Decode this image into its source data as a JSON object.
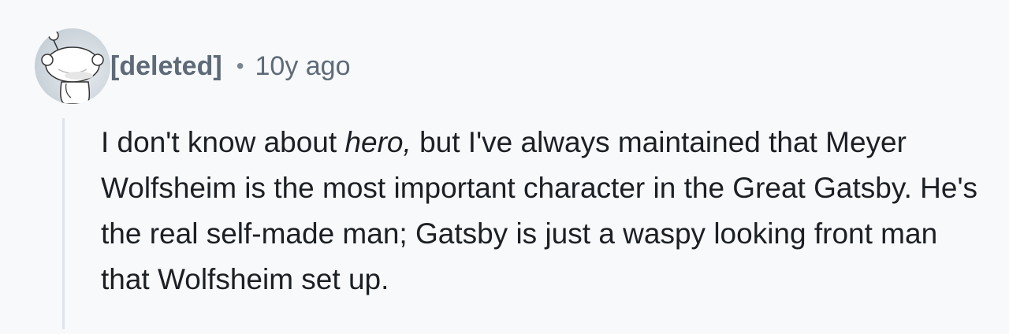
{
  "comment": {
    "author": "[deleted]",
    "separator": "•",
    "timestamp": "10y ago",
    "avatar_icon": "reddit-snoo-avatar",
    "body": {
      "before_em": "I don't know about ",
      "em": "hero,",
      "after_em": " but I've always maintained that Meyer Wolfsheim is the most important character in the Great Gatsby. He's the real self-made man; Gatsby is just a waspy looking front man that Wolfsheim set up."
    }
  },
  "colors": {
    "background": "#f7f9fb",
    "meta_text": "#5e6a78",
    "body_text": "#1c1f23",
    "thread_line": "#dfe5ec"
  }
}
